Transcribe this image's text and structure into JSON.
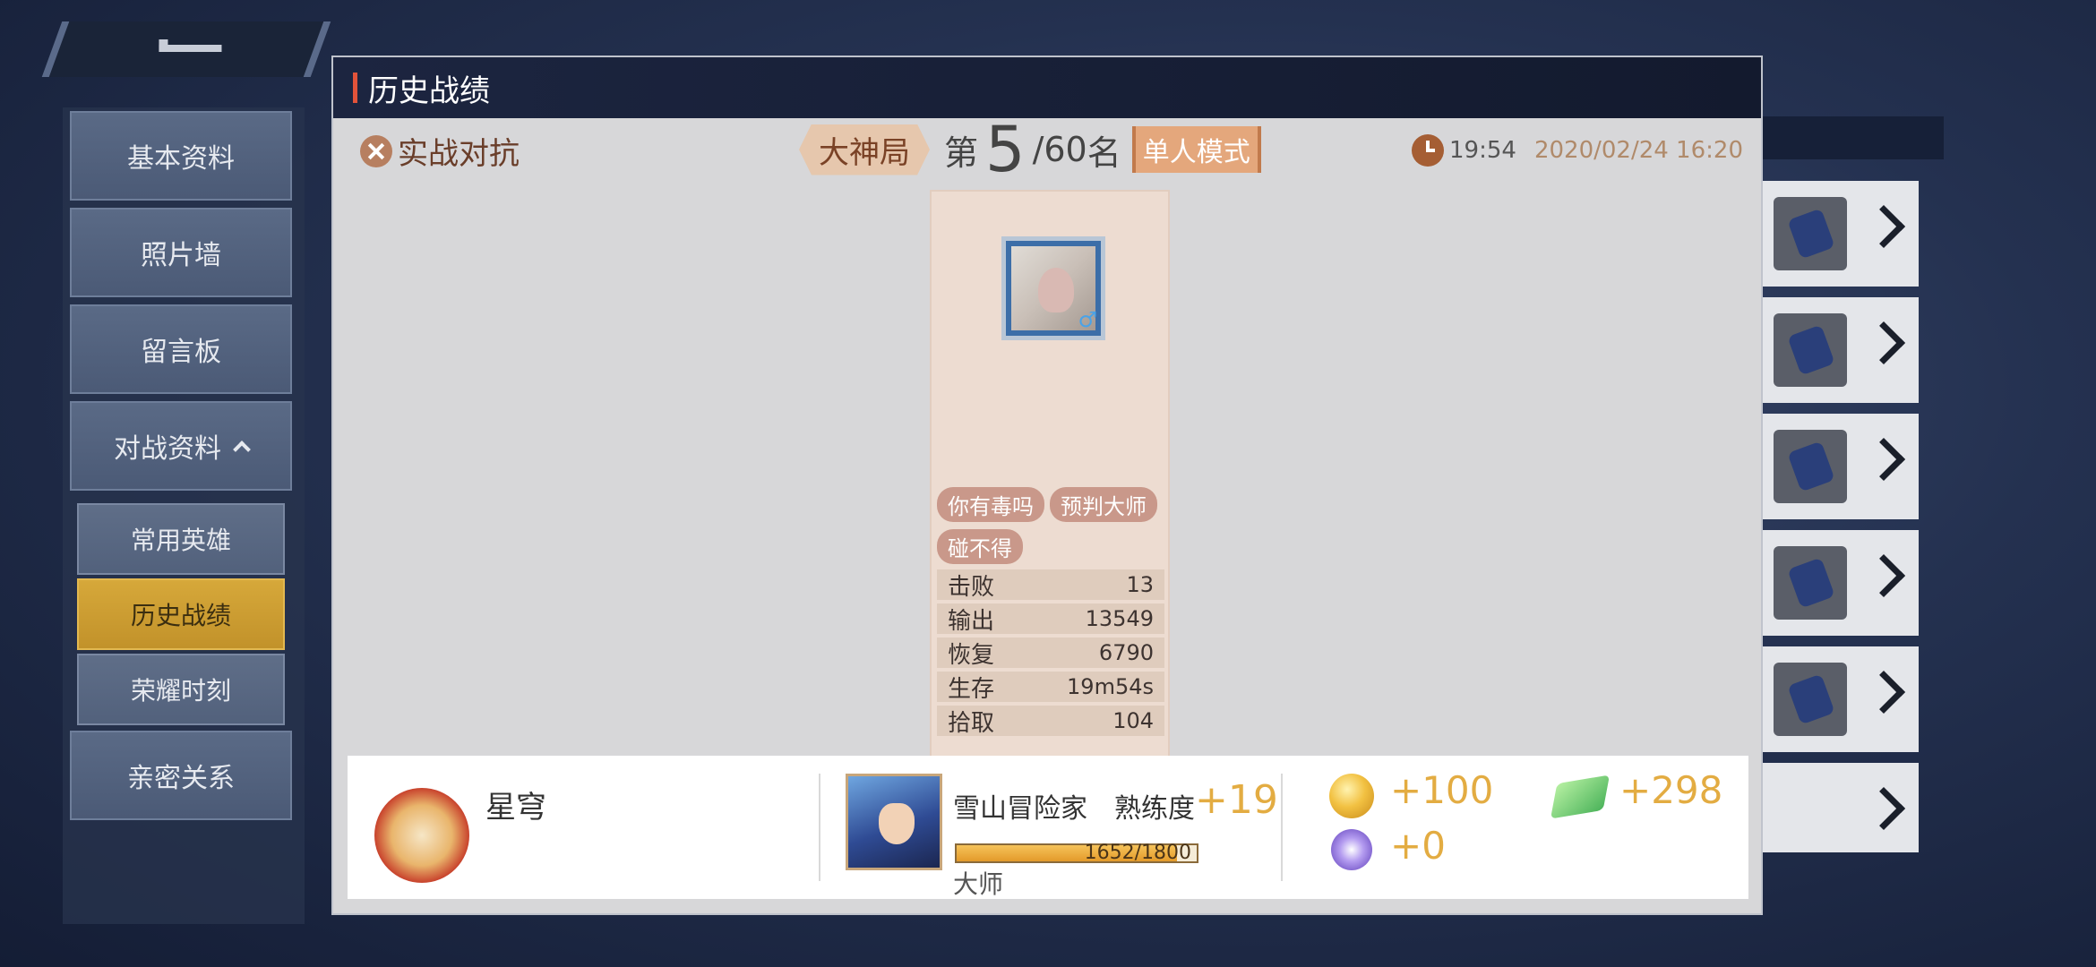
{
  "sidebar": {
    "items": [
      {
        "label": "基本资料"
      },
      {
        "label": "照片墙"
      },
      {
        "label": "留言板"
      },
      {
        "label": "对战资料"
      },
      {
        "label": "亲密关系"
      }
    ],
    "sub_items": [
      {
        "label": "常用英雄"
      },
      {
        "label": "历史战绩"
      },
      {
        "label": "荣耀时刻"
      }
    ]
  },
  "modal": {
    "title": "历史战绩",
    "mode": "实战对抗",
    "tier": "大神局",
    "rank_prefix": "第",
    "rank": "5",
    "rank_total": "/60",
    "rank_suffix": "名",
    "mode_tag": "单人模式",
    "duration": "19:54",
    "datetime": "2020/02/24 16:20"
  },
  "player_card": {
    "gender_icon": "♂",
    "badges": [
      "你有毒吗",
      "预判大师",
      "碰不得"
    ],
    "stats": [
      {
        "label": "击败",
        "value": "13"
      },
      {
        "label": "输出",
        "value": "13549"
      },
      {
        "label": "恢复",
        "value": "6790"
      },
      {
        "label": "生存",
        "value": "19m54s"
      },
      {
        "label": "拾取",
        "value": "104"
      }
    ]
  },
  "reward": {
    "player_name": "星穹",
    "hero_name": "雪山冒险家",
    "proficiency_label": "熟练度",
    "proficiency_gain": "+19",
    "proficiency_progress": "1652/1800",
    "proficiency_fraction": 0.918,
    "proficiency_rank": "大师",
    "coins": "+100",
    "gems": "+298",
    "orbs": "+0"
  },
  "colors": {
    "accent_gold": "#e3ac42",
    "active_tab": "#d6a83a",
    "title_bar_mark": "#e2533a"
  },
  "icons": [
    "clock-icon",
    "crossed-swords-icon",
    "coin-icon",
    "gem-icon",
    "orb-icon",
    "chevron-right-icon",
    "caret-up-icon"
  ]
}
